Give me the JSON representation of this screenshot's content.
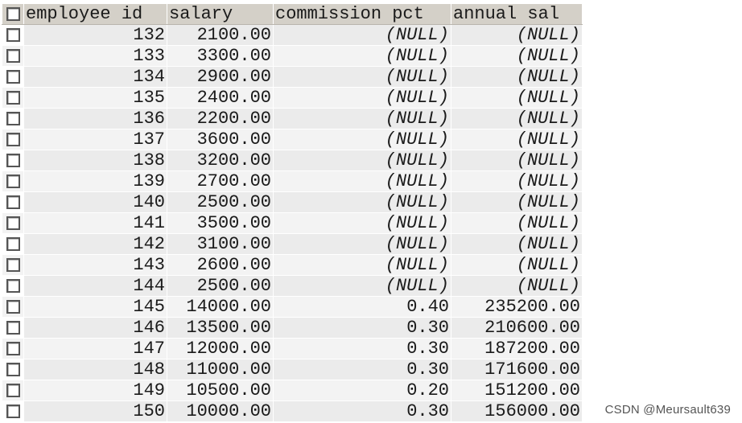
{
  "columns": [
    "employee id",
    "salary",
    "commission pct",
    "annual sal"
  ],
  "rows": [
    {
      "employee_id": "132",
      "salary": "2100.00",
      "commission_pct": "(NULL)",
      "annual_sal": "(NULL)"
    },
    {
      "employee_id": "133",
      "salary": "3300.00",
      "commission_pct": "(NULL)",
      "annual_sal": "(NULL)"
    },
    {
      "employee_id": "134",
      "salary": "2900.00",
      "commission_pct": "(NULL)",
      "annual_sal": "(NULL)"
    },
    {
      "employee_id": "135",
      "salary": "2400.00",
      "commission_pct": "(NULL)",
      "annual_sal": "(NULL)"
    },
    {
      "employee_id": "136",
      "salary": "2200.00",
      "commission_pct": "(NULL)",
      "annual_sal": "(NULL)"
    },
    {
      "employee_id": "137",
      "salary": "3600.00",
      "commission_pct": "(NULL)",
      "annual_sal": "(NULL)"
    },
    {
      "employee_id": "138",
      "salary": "3200.00",
      "commission_pct": "(NULL)",
      "annual_sal": "(NULL)"
    },
    {
      "employee_id": "139",
      "salary": "2700.00",
      "commission_pct": "(NULL)",
      "annual_sal": "(NULL)"
    },
    {
      "employee_id": "140",
      "salary": "2500.00",
      "commission_pct": "(NULL)",
      "annual_sal": "(NULL)"
    },
    {
      "employee_id": "141",
      "salary": "3500.00",
      "commission_pct": "(NULL)",
      "annual_sal": "(NULL)"
    },
    {
      "employee_id": "142",
      "salary": "3100.00",
      "commission_pct": "(NULL)",
      "annual_sal": "(NULL)"
    },
    {
      "employee_id": "143",
      "salary": "2600.00",
      "commission_pct": "(NULL)",
      "annual_sal": "(NULL)"
    },
    {
      "employee_id": "144",
      "salary": "2500.00",
      "commission_pct": "(NULL)",
      "annual_sal": "(NULL)"
    },
    {
      "employee_id": "145",
      "salary": "14000.00",
      "commission_pct": "0.40",
      "annual_sal": "235200.00"
    },
    {
      "employee_id": "146",
      "salary": "13500.00",
      "commission_pct": "0.30",
      "annual_sal": "210600.00"
    },
    {
      "employee_id": "147",
      "salary": "12000.00",
      "commission_pct": "0.30",
      "annual_sal": "187200.00"
    },
    {
      "employee_id": "148",
      "salary": "11000.00",
      "commission_pct": "0.30",
      "annual_sal": "171600.00"
    },
    {
      "employee_id": "149",
      "salary": "10500.00",
      "commission_pct": "0.20",
      "annual_sal": "151200.00"
    },
    {
      "employee_id": "150",
      "salary": "10000.00",
      "commission_pct": "0.30",
      "annual_sal": "156000.00"
    }
  ],
  "watermark": "CSDN @Meursault639"
}
